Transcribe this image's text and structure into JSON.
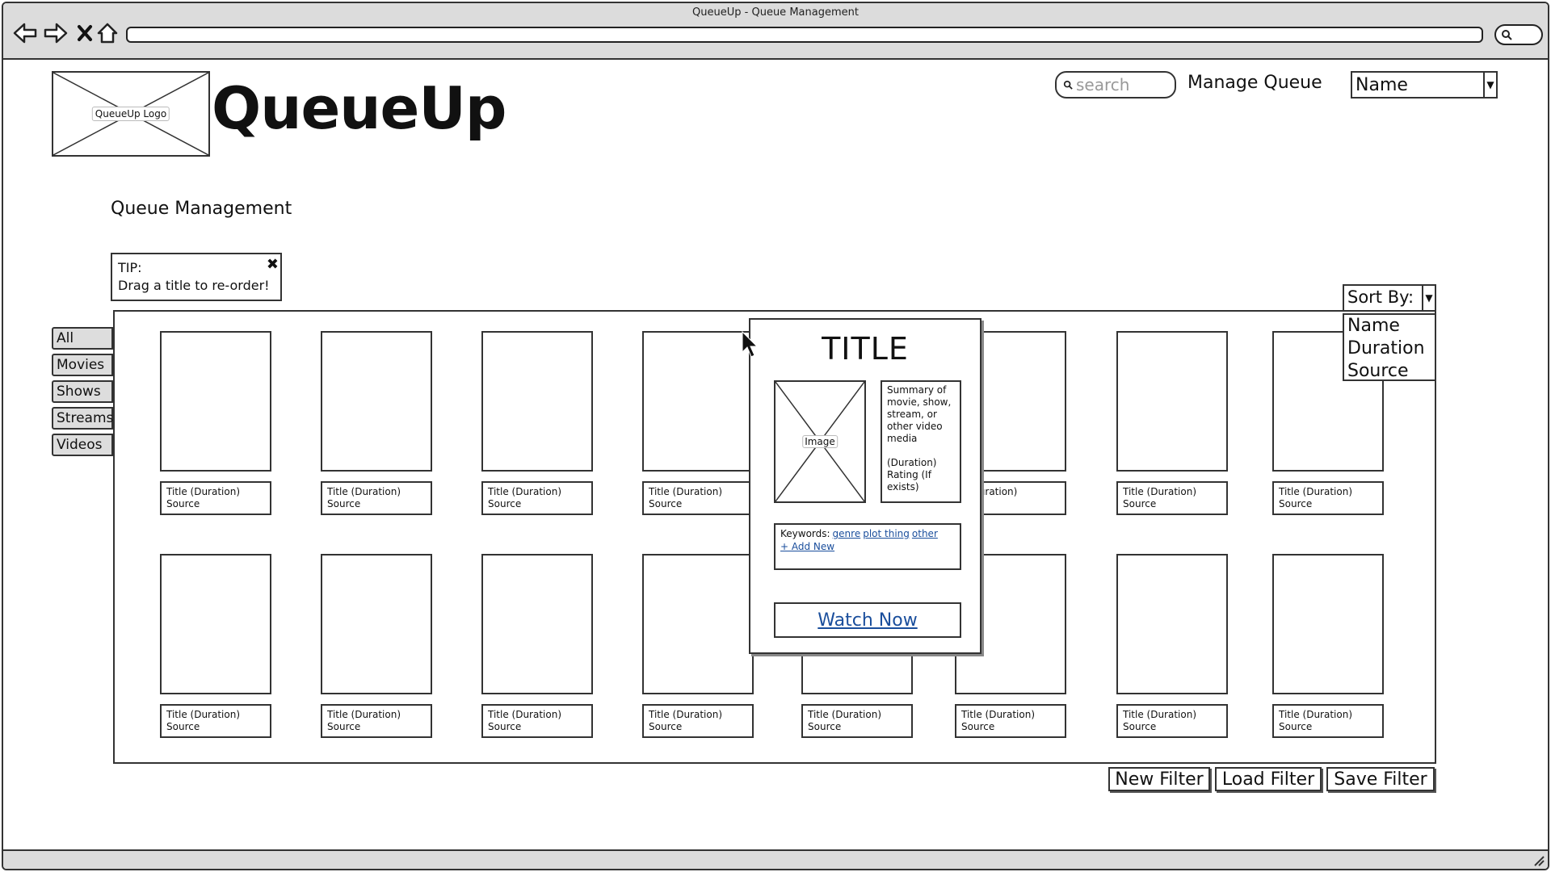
{
  "window": {
    "title": "QueueUp - Queue Management"
  },
  "header": {
    "logo_label": "QueueUp Logo",
    "app_title": "QueueUp",
    "search_placeholder": "search",
    "manage_queue_label": "Manage Queue",
    "select_value": "Name"
  },
  "page": {
    "heading": "Queue Management"
  },
  "tip": {
    "line1": "TIP:",
    "line2": "Drag a title to re-order!"
  },
  "sidebar": {
    "tabs": [
      "All",
      "Movies",
      "Shows",
      "Streams",
      "Videos"
    ]
  },
  "sort": {
    "label": "Sort By:",
    "options": [
      "Name",
      "Duration",
      "Source"
    ]
  },
  "tiles": {
    "caption_line1": "Title (Duration)",
    "caption_line2": "Source",
    "partial_line1": ": (Duration)",
    "partial_line2": "rce"
  },
  "popup": {
    "title": "TITLE",
    "image_label": "Image",
    "summary": [
      "Summary of",
      "movie, show,",
      "stream, or",
      "other video",
      "media",
      "",
      "(Duration)",
      "Rating (If",
      "exists)"
    ],
    "keywords_label": "Keywords:",
    "keywords": [
      "genre",
      "plot thing",
      "other"
    ],
    "add_new": "+ Add New",
    "watch_now": "Watch Now"
  },
  "filters": {
    "new": "New Filter",
    "load": "Load Filter",
    "save": "Save Filter"
  }
}
